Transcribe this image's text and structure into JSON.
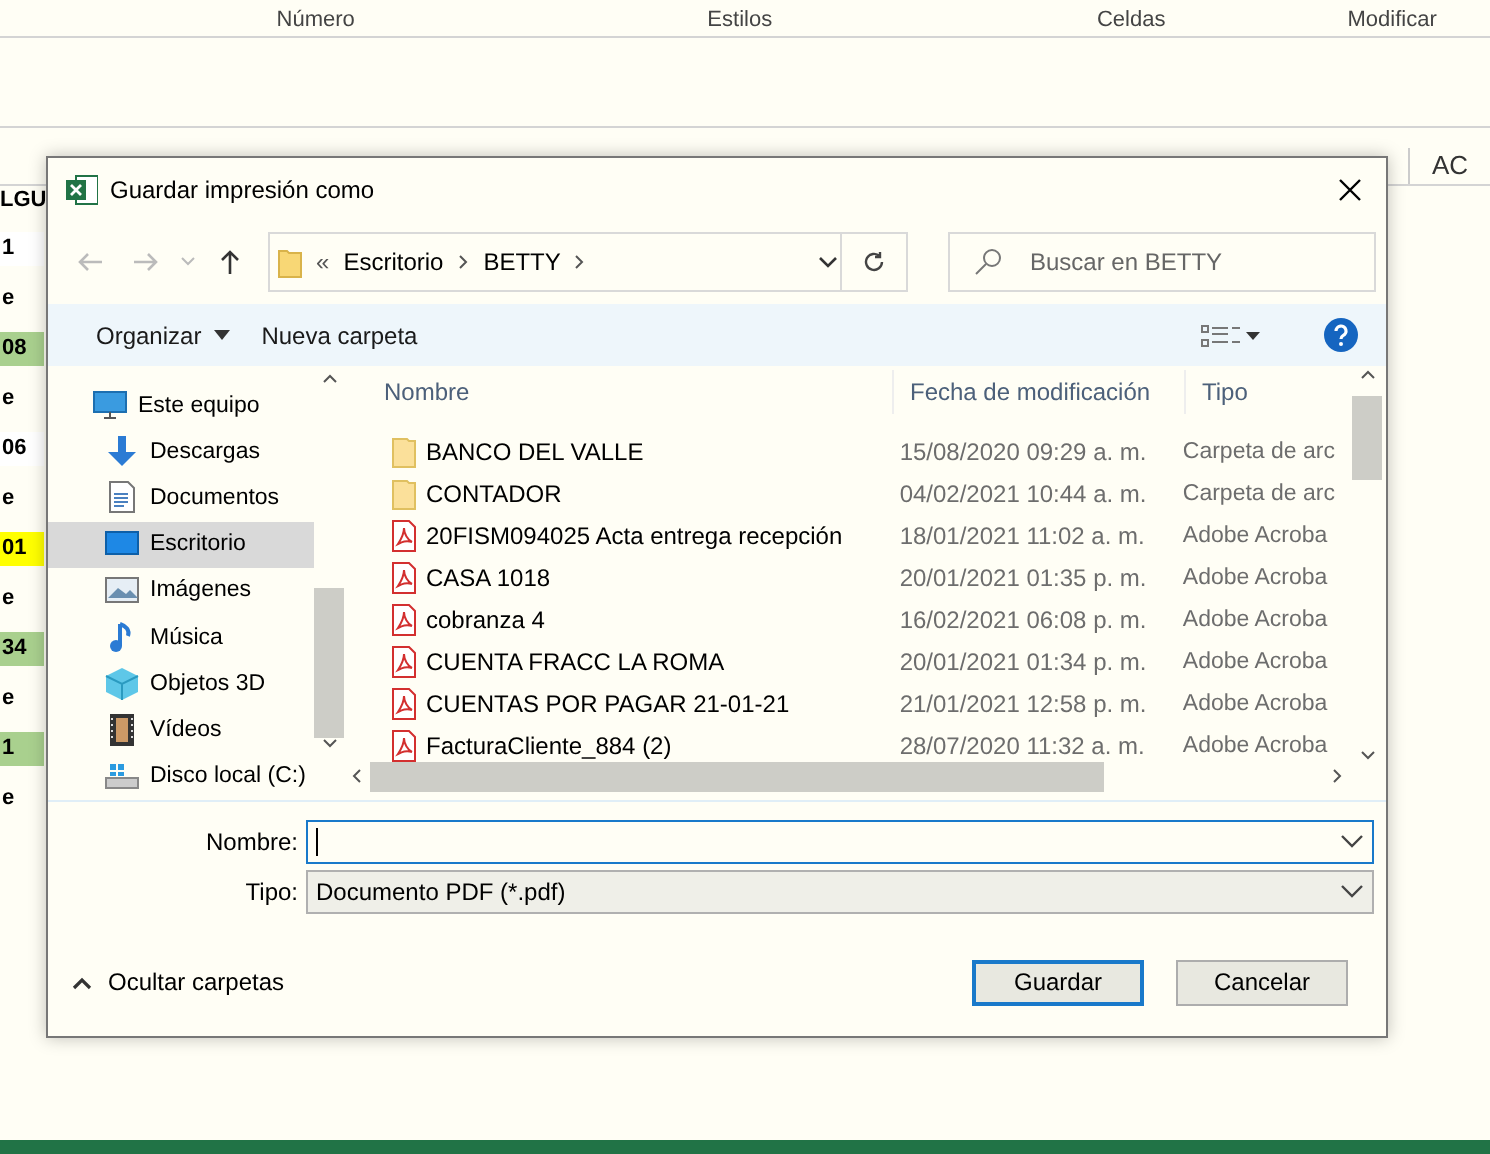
{
  "background": {
    "ribbon_groups": [
      "Número",
      "Estilos",
      "Celdas",
      "Modificar"
    ],
    "column_headers": [
      "AC"
    ],
    "row_label": "LGU",
    "left_cells": [
      {
        "text": "1",
        "color": "#ffffff"
      },
      {
        "text": "e",
        "color": "#fffef5"
      },
      {
        "text": "08",
        "color": "#a9d08e"
      },
      {
        "text": "e",
        "color": "#fffef5"
      },
      {
        "text": "06",
        "color": "#ffffff"
      },
      {
        "text": "e",
        "color": "#fffef5"
      },
      {
        "text": "01",
        "color": "#ffff00"
      },
      {
        "text": "e",
        "color": "#fffef5"
      },
      {
        "text": "34",
        "color": "#a9d08e"
      },
      {
        "text": "e",
        "color": "#fffef5"
      },
      {
        "text": "1",
        "color": "#a9d08e"
      },
      {
        "text": "e",
        "color": "#fffef5"
      }
    ]
  },
  "dialog": {
    "title": "Guardar impresión como",
    "nav": {
      "back_disabled": true,
      "forward_disabled": true
    },
    "breadcrumb": {
      "overflow": "«",
      "parts": [
        "Escritorio",
        "BETTY"
      ]
    },
    "search": {
      "placeholder": "Buscar en BETTY"
    },
    "toolbar": [
      "Organizar",
      "Nueva carpeta"
    ],
    "sidebar": [
      {
        "label": "Este equipo",
        "kind": "computer",
        "selected": false
      },
      {
        "label": "Descargas",
        "kind": "download",
        "selected": false
      },
      {
        "label": "Documentos",
        "kind": "document",
        "selected": false
      },
      {
        "label": "Escritorio",
        "kind": "desktop",
        "selected": true
      },
      {
        "label": "Imágenes",
        "kind": "image",
        "selected": false
      },
      {
        "label": "Música",
        "kind": "music",
        "selected": false
      },
      {
        "label": "Objetos 3D",
        "kind": "cube",
        "selected": false
      },
      {
        "label": "Vídeos",
        "kind": "film",
        "selected": false
      },
      {
        "label": "Disco local (C:)",
        "kind": "drive",
        "selected": false
      }
    ],
    "columns": [
      "Nombre",
      "Fecha de modificación",
      "Tipo"
    ],
    "rows": [
      {
        "name": "BANCO DEL VALLE",
        "date": "15/08/2020 09:29 a. m.",
        "type": "Carpeta de arc",
        "kind": "folder"
      },
      {
        "name": "CONTADOR",
        "date": "04/02/2021 10:44 a. m.",
        "type": "Carpeta de arc",
        "kind": "folder"
      },
      {
        "name": "20FISM094025 Acta entrega recepción",
        "date": "18/01/2021 11:02 a. m.",
        "type": "Adobe Acroba",
        "kind": "pdf"
      },
      {
        "name": "CASA 1018",
        "date": "20/01/2021 01:35 p. m.",
        "type": "Adobe Acroba",
        "kind": "pdf"
      },
      {
        "name": "cobranza 4",
        "date": "16/02/2021 06:08 p. m.",
        "type": "Adobe Acroba",
        "kind": "pdf"
      },
      {
        "name": "CUENTA FRACC LA ROMA",
        "date": "20/01/2021 01:34 p. m.",
        "type": "Adobe Acroba",
        "kind": "pdf"
      },
      {
        "name": "CUENTAS POR PAGAR 21-01-21",
        "date": "21/01/2021 12:58 p. m.",
        "type": "Adobe Acroba",
        "kind": "pdf"
      },
      {
        "name": "FacturaCliente_884 (2)",
        "date": "28/07/2020 11:32 a. m.",
        "type": "Adobe Acroba",
        "kind": "pdf"
      }
    ],
    "fields": [
      {
        "label": "Nombre:",
        "kind": "input"
      },
      {
        "label": "Tipo:",
        "value": "Documento PDF (*.pdf)",
        "kind": "select"
      }
    ],
    "hide_folders": "Ocultar carpetas",
    "buttons": [
      {
        "label": "Guardar",
        "default": true
      },
      {
        "label": "Cancelar",
        "default": false
      }
    ]
  }
}
